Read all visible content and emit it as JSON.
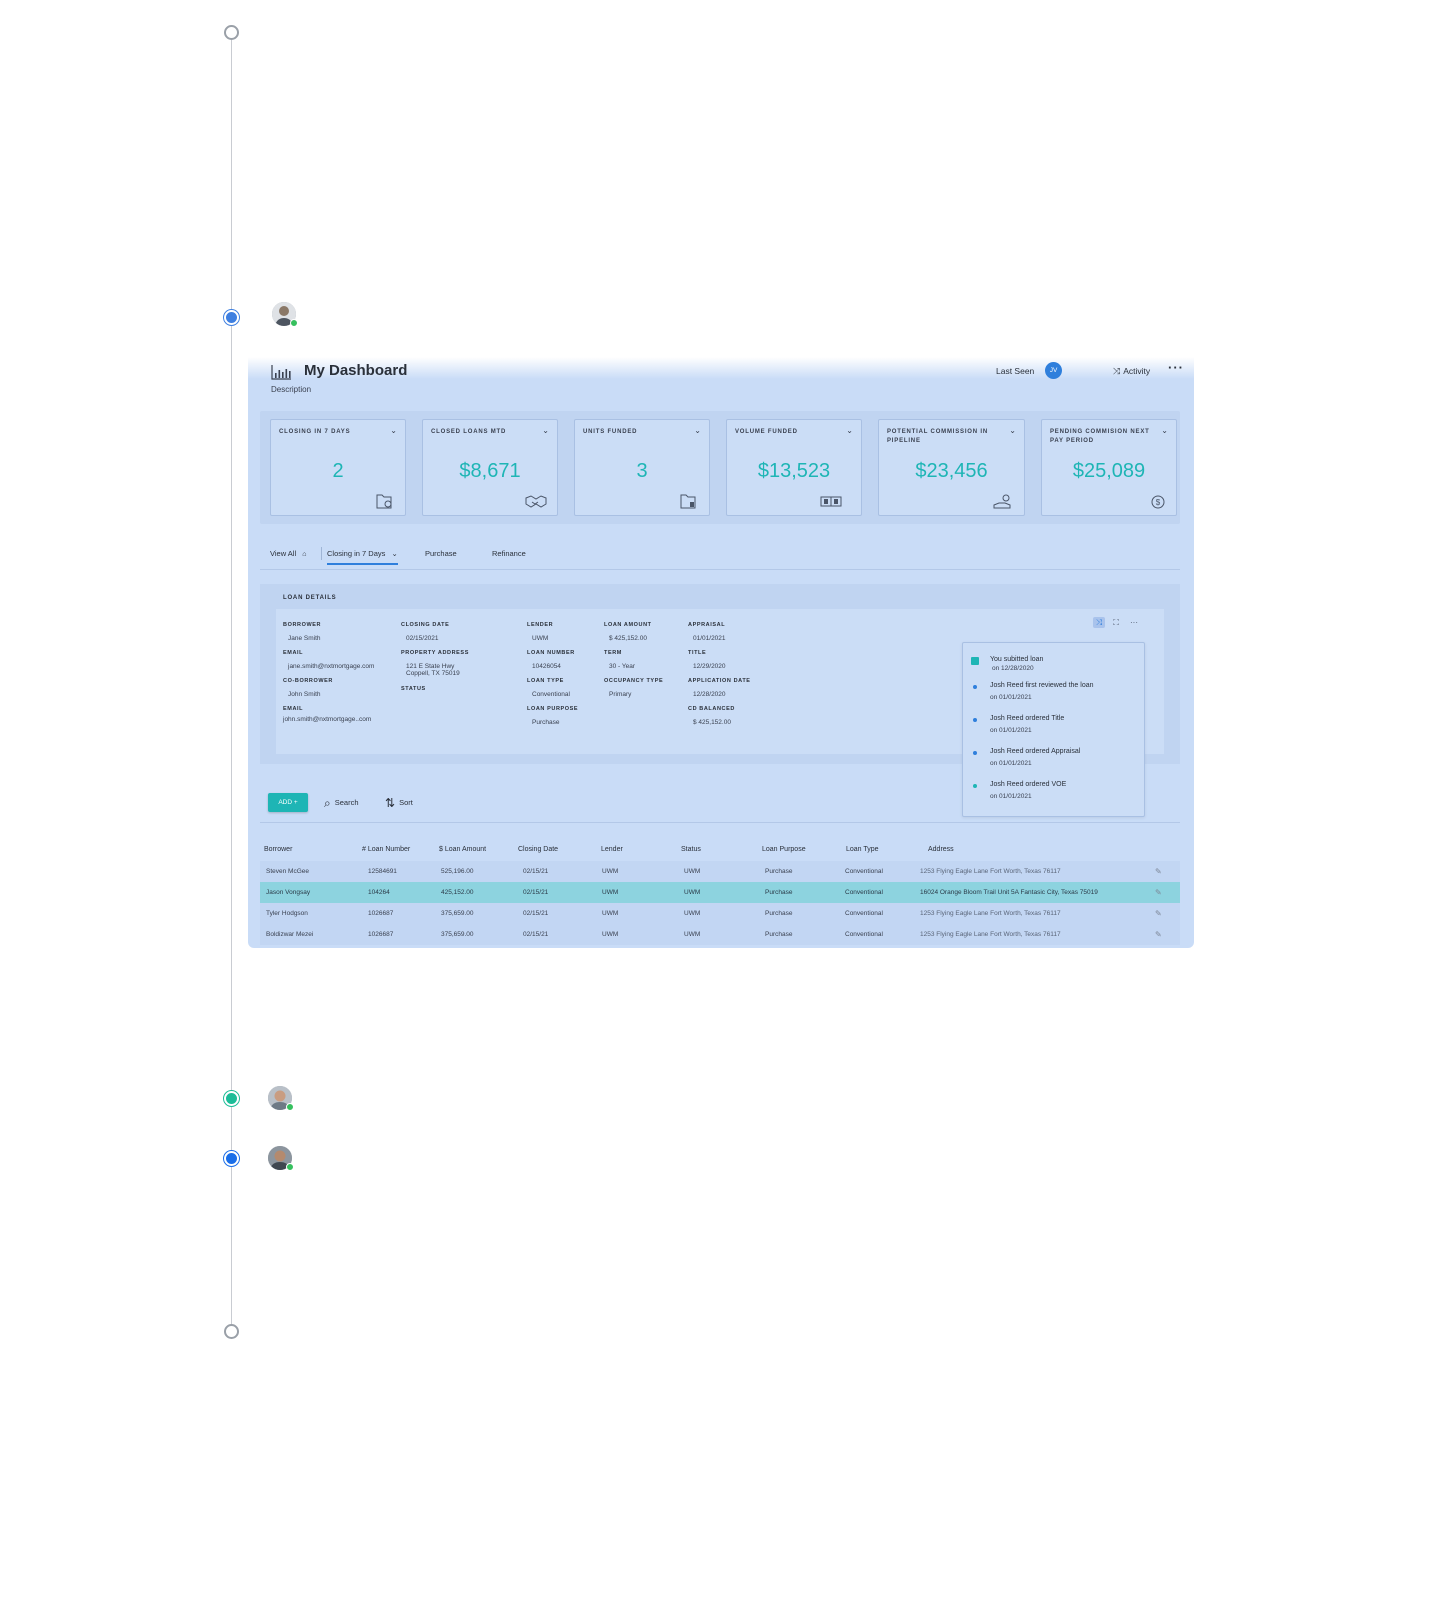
{
  "header": {
    "title": "My Dashboard",
    "description": "Description",
    "last_seen_label": "Last Seen",
    "user_initials": "JV",
    "activity_label": "Activity",
    "more_glyph": "···"
  },
  "stats": [
    {
      "label": "CLOSING IN 7 DAYS",
      "value": "2",
      "icon": "folder-clock-icon"
    },
    {
      "label": "CLOSED LOANS MTD",
      "value": "$8,671",
      "icon": "handshake-icon"
    },
    {
      "label": "UNITS FUNDED",
      "value": "3",
      "icon": "folder-icon"
    },
    {
      "label": "VOLUME FUNDED",
      "value": "$13,523",
      "icon": "cash-icon"
    },
    {
      "label": "POTENTIAL COMMISSION IN PIPELINE",
      "value": "$23,456",
      "icon": "hand-coins-icon"
    },
    {
      "label": "PENDING COMMISION NEXT PAY PERIOD",
      "value": "$25,089",
      "icon": "dollar-circle-icon"
    }
  ],
  "tabs": [
    {
      "label": "View All"
    },
    {
      "label": "Closing in 7 Days",
      "active": true
    },
    {
      "label": "Purchase"
    },
    {
      "label": "Refinance"
    }
  ],
  "loan_details": {
    "title": "LOAN DETAILS",
    "borrower_label": "BORROWER",
    "borrower": "Jane Smith",
    "email_label": "EMAIL",
    "email": "jane.smith@nxtmortgage.com",
    "coborrower_label": "CO-BORROWER",
    "coborrower": "John Smith",
    "email2_label": "EMAIL",
    "email2": "john.smith@nxtmortgage..com",
    "closing_date_label": "CLOSING DATE",
    "closing_date": "02/15/2021",
    "property_address_label": "PROPERTY ADDRESS",
    "property_address_1": "121 E State Hwy",
    "property_address_2": "Coppell, TX 75019",
    "status_label": "STATUS",
    "lender_label": "LENDER",
    "lender": "UWM",
    "loan_number_label": "LOAN NUMBER",
    "loan_number": "10426054",
    "loan_type_label": "LOAN TYPE",
    "loan_type": "Conventional",
    "loan_purpose_label": "LOAN PURPOSE",
    "loan_purpose": "Purchase",
    "loan_amount_label": "LOAN AMOUNT",
    "loan_amount": "$ 425,152.00",
    "term_label": "TERM",
    "term": "30 - Year",
    "occupancy_type_label": "OCCUPANCY TYPE",
    "occupancy_type": "Primary",
    "appraisal_label": "APPRAISAL",
    "appraisal": "01/01/2021",
    "title_label": "TITLE",
    "title_value": "12/29/2020",
    "application_date_label": "APPLICATION DATE",
    "application_date": "12/28/2020",
    "cd_balanced_label": "CD BALANCED",
    "cd_balanced": "$ 425,152.00"
  },
  "activity_feed": [
    {
      "title": "You subitted loan",
      "date": "on 12/28/2020"
    },
    {
      "title": "Josh Reed first reviewed the loan",
      "date": "on 01/01/2021"
    },
    {
      "title": "Josh Reed ordered Title",
      "date": "on 01/01/2021"
    },
    {
      "title": "Josh Reed ordered Appraisal",
      "date": "on 01/01/2021"
    },
    {
      "title": "Josh Reed ordered VOE",
      "date": "on 01/01/2021"
    }
  ],
  "toolbar": {
    "add_label": "ADD +",
    "search_label": "Search",
    "sort_label": "Sort"
  },
  "table": {
    "columns": [
      "Borrower",
      "# Loan Number",
      "$ Loan Amount",
      "Closing Date",
      "Lender",
      "Status",
      "Loan Purpose",
      "Loan Type",
      "Address"
    ],
    "rows": [
      [
        "Steven McGee",
        "12584691",
        "525,196.00",
        "02/15/21",
        "UWM",
        "UWM",
        "Purchase",
        "Conventional",
        "1253 Flying Eagle Lane Fort Worth, Texas 76117"
      ],
      [
        "Jason Vongsay",
        "104264",
        "425,152.00",
        "02/15/21",
        "UWM",
        "UWM",
        "Purchase",
        "Conventional",
        "16024 Orange Bloom Trail Unit 5A Fantasic City, Texas 75019"
      ],
      [
        "Tyler Hodgson",
        "1026687",
        "375,659.00",
        "02/15/21",
        "UWM",
        "UWM",
        "Purchase",
        "Conventional",
        "1253 Flying Eagle Lane Fort Worth, Texas 76117"
      ],
      [
        "Boldizwar Mezei",
        "1026687",
        "375,659.00",
        "02/15/21",
        "UWM",
        "UWM",
        "Purchase",
        "Conventional",
        "1253 Flying Eagle Lane Fort Worth, Texas 76117"
      ]
    ],
    "selected_row": 1
  },
  "colors": {
    "accent": "#1eb5b5",
    "primary": "#2f7fdc",
    "panel_bg": "#c9dcf7",
    "selected_row": "#8dd3df",
    "online": "#36c05e"
  }
}
